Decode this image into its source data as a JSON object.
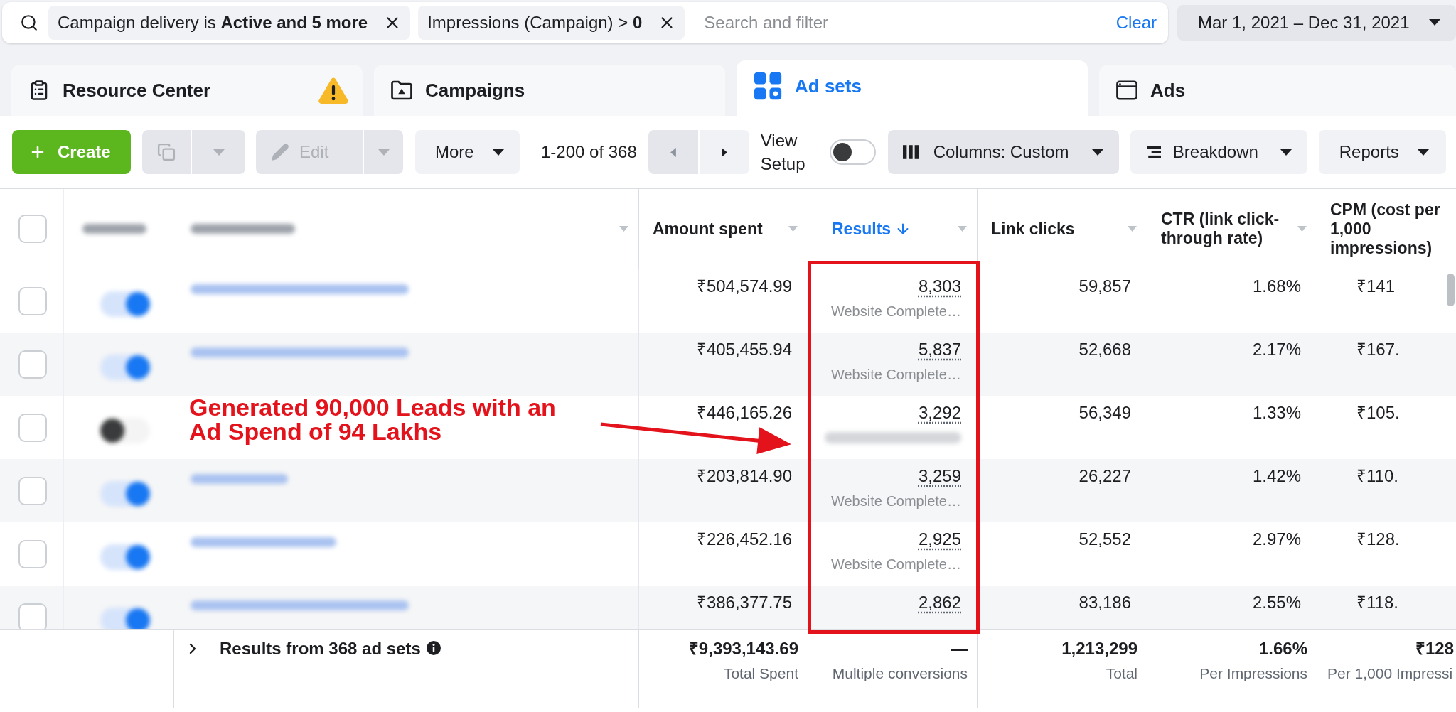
{
  "filter_bar": {
    "chips": [
      {
        "text": "Campaign delivery is **Active and 5 more**"
      },
      {
        "text": "Impressions (Campaign) > **0**"
      }
    ],
    "search": {
      "placeholder": "Search and filter"
    },
    "clear": "Clear",
    "date_range": "Mar 1, 2021 – Dec 31, 2021"
  },
  "tabs": [
    {
      "label": "Resource Center",
      "selected": false,
      "alert": true
    },
    {
      "label": "Campaigns",
      "selected": false,
      "alert": false
    },
    {
      "label": "Ad sets",
      "selected": true,
      "alert": false
    },
    {
      "label": "Ads",
      "selected": false,
      "alert": false
    }
  ],
  "toolbar": {
    "create": "Create",
    "duplicate": {
      "disabled": true
    },
    "edit": {
      "label": "Edit",
      "disabled": true
    },
    "more": "More",
    "page_range": "1-200 of 368",
    "pager": {
      "previous": {
        "disabled": true
      },
      "next": {
        "disabled": false
      }
    },
    "view_setup": {
      "label": "View Setup",
      "on": false
    },
    "columns": "Columns: Custom",
    "breakdown": "Breakdown",
    "reports": "Reports"
  },
  "table": {
    "select_all": {
      "checked": false
    },
    "columns": [
      {
        "kind": "redacted"
      },
      {
        "kind": "redacted"
      },
      {
        "kind": "metric",
        "label": "Amount spent",
        "sorted": false
      },
      {
        "kind": "metric",
        "label": "Results",
        "sorted": true
      },
      {
        "kind": "metric",
        "label": "Link clicks",
        "sorted": false
      },
      {
        "kind": "metric",
        "label": "CTR (link click-through rate)",
        "sorted": false
      },
      {
        "kind": "metric",
        "label": "CPM (cost per 1,000 impressions)",
        "sorted": false
      }
    ],
    "rows": [
      {
        "checked": false,
        "on": true,
        "name": {
          "kind": "redacted"
        },
        "amount_spent": "₹504,574.99",
        "results": {
          "value": "8,303",
          "note": {
            "kind": "text",
            "text": "Website Complete…"
          }
        },
        "link_clicks": "59,857",
        "ctr": "1.68%",
        "cpm": "₹141"
      },
      {
        "checked": false,
        "on": true,
        "name": {
          "kind": "redacted"
        },
        "amount_spent": "₹405,455.94",
        "results": {
          "value": "5,837",
          "note": {
            "kind": "text",
            "text": "Website Complete…"
          }
        },
        "link_clicks": "52,668",
        "ctr": "2.17%",
        "cpm": "₹167."
      },
      {
        "checked": false,
        "on": false,
        "amount_spent": "₹446,165.26",
        "results": {
          "value": "3,292",
          "note": {
            "kind": "redacted"
          }
        },
        "link_clicks": "56,349",
        "ctr": "1.33%",
        "cpm": "₹105."
      },
      {
        "checked": false,
        "on": true,
        "name": {
          "kind": "redacted"
        },
        "amount_spent": "₹203,814.90",
        "results": {
          "value": "3,259",
          "note": {
            "kind": "text",
            "text": "Website Complete…"
          }
        },
        "link_clicks": "26,227",
        "ctr": "1.42%",
        "cpm": "₹110."
      },
      {
        "checked": false,
        "on": true,
        "name": {
          "kind": "redacted"
        },
        "amount_spent": "₹226,452.16",
        "results": {
          "value": "2,925",
          "note": {
            "kind": "text",
            "text": "Website Complete…"
          }
        },
        "link_clicks": "52,552",
        "ctr": "2.97%",
        "cpm": "₹128."
      },
      {
        "checked": false,
        "on": true,
        "name": {
          "kind": "redacted"
        },
        "amount_spent": "₹386,377.75",
        "results": {
          "value": "2,862"
        },
        "link_clicks": "83,186",
        "ctr": "2.55%",
        "cpm": "₹118."
      }
    ]
  },
  "footer": {
    "label": "Results from 368 ad sets",
    "expanded": false,
    "totals": [
      {
        "value": "₹9,393,143.69",
        "caption": "Total Spent"
      },
      {
        "value": "—",
        "caption": "Multiple conversions"
      },
      {
        "value": "1,213,299",
        "caption": "Total"
      },
      {
        "value": "1.66%",
        "caption": "Per Impressions"
      },
      {
        "value": "₹128",
        "caption": "Per 1,000 Impressi"
      }
    ]
  },
  "annotation": {
    "text": "Generated 90,000 Leads with an Ad Spend of 94 Lakhs"
  }
}
